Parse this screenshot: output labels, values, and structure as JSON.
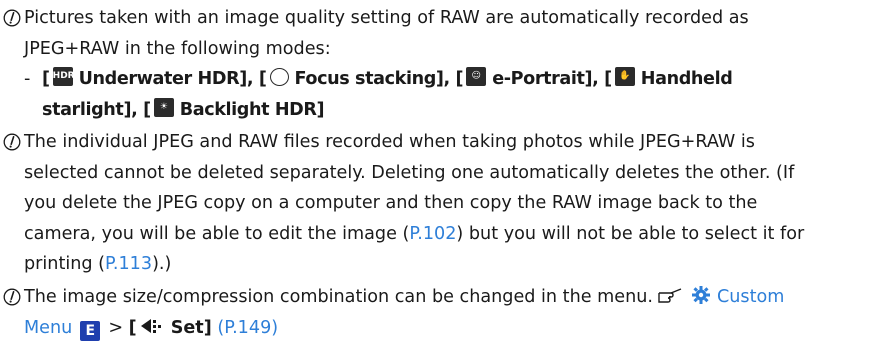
{
  "note1": {
    "line1": "Pictures taken with an image quality setting of RAW are automatically recorded as",
    "line2": "JPEG+RAW in the following modes:"
  },
  "modes": {
    "dash": "-",
    "open": "[",
    "sep": "], [",
    "close": "]",
    "underwater_hdr": "Underwater HDR",
    "focus_stacking": "Focus stacking",
    "e_portrait": "e-Portrait",
    "handheld": "Handheld",
    "starlight": "starlight",
    "backlight_hdr": "Backlight HDR"
  },
  "note2": {
    "line1": "The individual JPEG and RAW files recorded when taking photos while JPEG+RAW is",
    "line2": "selected cannot be deleted separately. Deleting one automatically deletes the other. (If",
    "line3": "you delete the JPEG copy on a computer and then copy the RAW image back to the",
    "line4a": "camera, you will be able to edit the image (",
    "ref_edit": "P.102",
    "line4b": ") but you will not be able to select it for",
    "line5a": "printing (",
    "ref_print": "P.113",
    "line5b": ").)"
  },
  "note3": {
    "line1": "The image size/compression combination can be changed in the menu.",
    "custom_menu_a": "Custom",
    "custom_menu_b": "Menu",
    "menu_letter": "E",
    "arrow": ">",
    "set_open": "[",
    "set_label": "Set]",
    "ref_set": "(P.149)"
  },
  "colors": {
    "link": "#2e7fd8",
    "menu_badge": "#1f3fae",
    "text": "#1a1a1a"
  }
}
